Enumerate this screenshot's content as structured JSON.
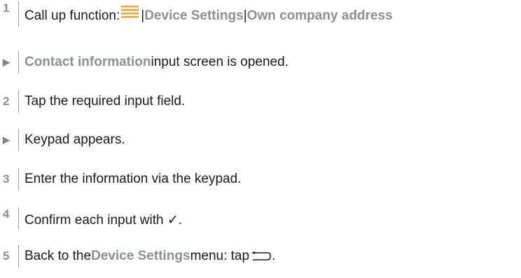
{
  "steps": [
    {
      "marker": "1",
      "parts": {
        "before": "Call up function: ",
        "sep1": " | ",
        "hl1": "Device Settings",
        "sep2": " | ",
        "hl2": "Own company address"
      }
    },
    {
      "marker": "▶",
      "parts": {
        "hl": "Contact information",
        "after": " input screen is opened."
      }
    },
    {
      "marker": "2",
      "text": "Tap the required input field."
    },
    {
      "marker": "▶",
      "text": "Keypad appears."
    },
    {
      "marker": "3",
      "text": "Enter the information via the keypad."
    },
    {
      "marker": "4",
      "text": "Confirm each input with ✓."
    },
    {
      "marker": "5",
      "parts": {
        "before": "Back to the ",
        "hl": "Device Settings",
        "after": " menu: tap ",
        "end": "."
      }
    }
  ],
  "icons": {
    "menu": "menu-icon",
    "back": "back-arrow-icon"
  },
  "colors": {
    "highlight_text": "#8a9098",
    "marker": "#8a8f96",
    "menu_icon": "#f2a23a"
  }
}
